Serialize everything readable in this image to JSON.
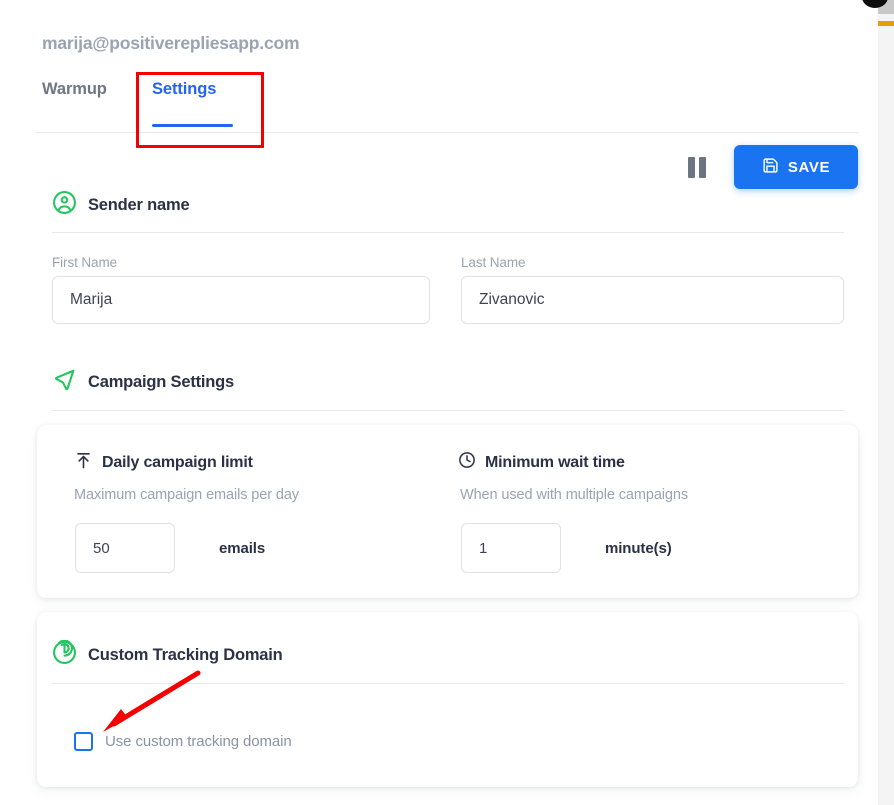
{
  "header": {
    "account_email": "marija@positiverepliesapp.com",
    "tabs": [
      {
        "label": "Warmup",
        "active": false
      },
      {
        "label": "Settings",
        "active": true
      }
    ]
  },
  "toolbar": {
    "pause_icon": "pause-icon",
    "save_label": "SAVE",
    "save_icon": "save-floppy-icon",
    "save_color": "#1a73f0"
  },
  "sender_name": {
    "icon": "account-circle-icon",
    "icon_color": "#22c55e",
    "title": "Sender name",
    "first_name": {
      "label": "First Name",
      "value": "Marija",
      "placeholder": "First Name"
    },
    "last_name": {
      "label": "Last Name",
      "value": "Zivanovic",
      "placeholder": "Last Name"
    }
  },
  "campaign_settings": {
    "icon": "send-arrow-icon",
    "icon_color": "#22c55e",
    "title": "Campaign Settings",
    "daily_limit": {
      "icon": "arrow-up-to-line-icon",
      "title": "Daily campaign limit",
      "description": "Maximum campaign emails per day",
      "value": "50",
      "unit": "emails"
    },
    "wait_time": {
      "icon": "clock-icon",
      "title": "Minimum wait time",
      "description": "When used with multiple campaigns",
      "value": "1",
      "unit": "minute(s)"
    }
  },
  "custom_tracking_domain": {
    "icon": "radar-tracking-icon",
    "icon_color": "#22c55e",
    "title": "Custom Tracking Domain",
    "checkbox": {
      "label": "Use custom tracking domain",
      "checked": false,
      "accent_color": "#1a73f0"
    }
  },
  "annotations": {
    "highlight_color": "#f50000",
    "settings_tab_box": "highlight-rectangle",
    "checkbox_arrow": "pointer-arrow"
  },
  "scrollbar": {
    "marker_color": "#e59b12",
    "thumb_color": "#c8c8c8"
  }
}
